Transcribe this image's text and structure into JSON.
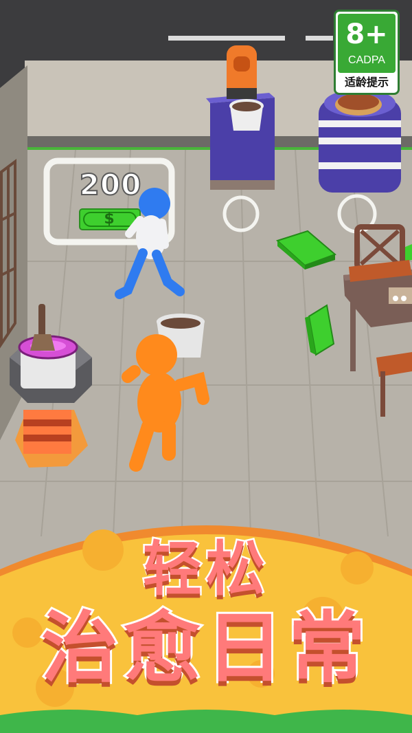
{
  "rating": {
    "age": "8+",
    "org": "CADPA",
    "hint": "适龄提示"
  },
  "pay_zone": {
    "price": "200",
    "currency_symbol": "$"
  },
  "slogan": {
    "line1": "轻松",
    "line2": "治愈日常"
  },
  "colors": {
    "floor": "#b7b2a9",
    "wall": "#8f8a80",
    "rating_green": "#39a935",
    "banner": "#f9c23c",
    "slogan_text": "#ff7a7a",
    "player": "#ff8a1c",
    "customer": "#2f7bf0",
    "cash": "#3ecf2e"
  }
}
